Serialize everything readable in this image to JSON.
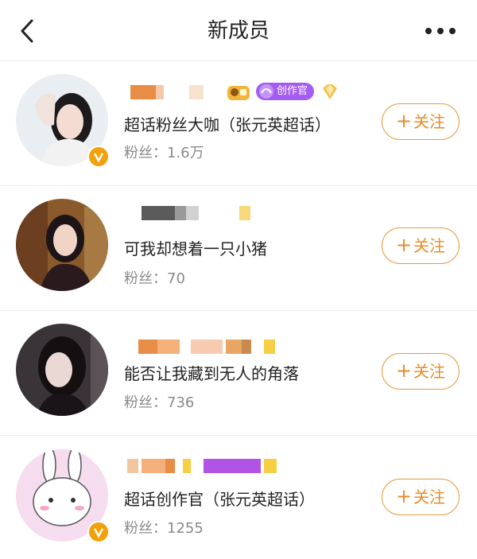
{
  "header": {
    "title": "新成员"
  },
  "badges": {
    "creator_label": "创作官"
  },
  "follow_label": "关注",
  "follow_plus": "+",
  "members": [
    {
      "bio": "超话粉丝大咖（张元英超话）",
      "fans": "粉丝：1.6万",
      "verified": true
    },
    {
      "bio": "可我却想着一只小猪",
      "fans": "粉丝：70",
      "verified": false
    },
    {
      "bio": "能否让我藏到无人的角落",
      "fans": "粉丝：736",
      "verified": false
    },
    {
      "bio": "超话创作官（张元英超话）",
      "fans": "粉丝：1255",
      "verified": true
    }
  ],
  "colors": {
    "accent": "#e88b2a",
    "creator_badge": "#a45cf1",
    "verified": "#f3a10a"
  }
}
